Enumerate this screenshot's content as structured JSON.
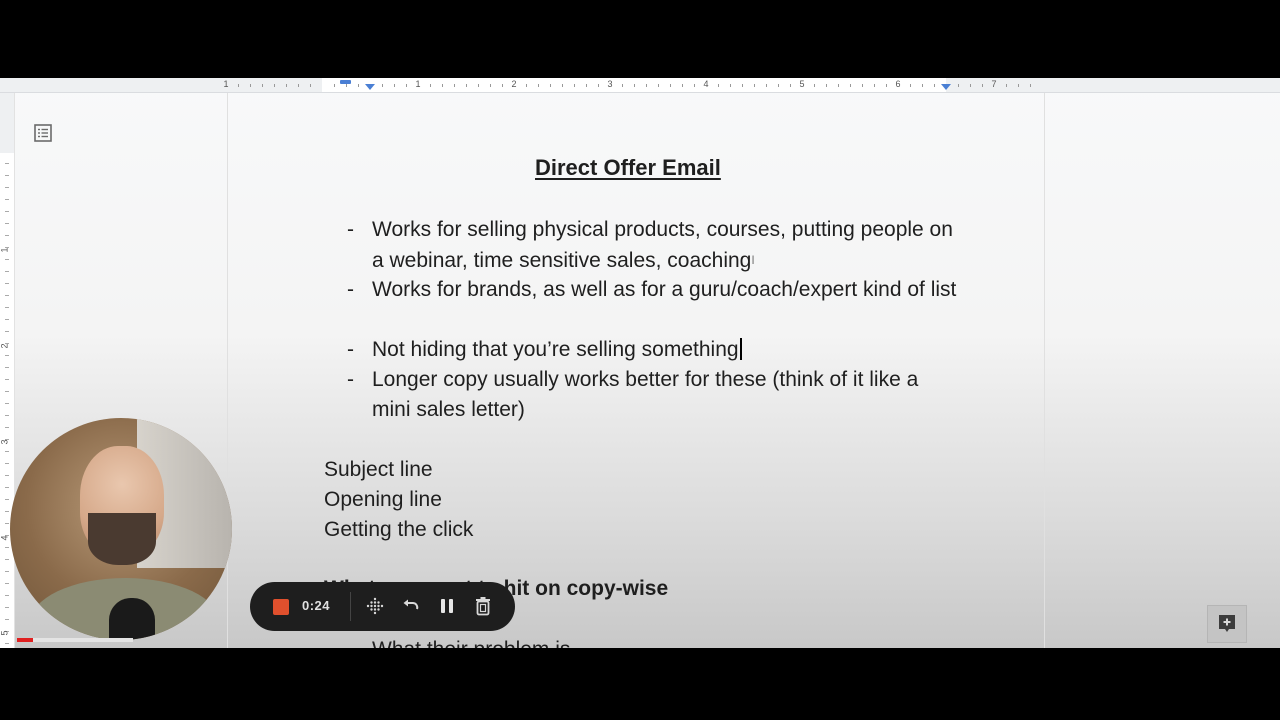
{
  "document": {
    "title": "Direct Offer Email",
    "bullets": [
      {
        "text": "Works for selling physical products, courses, putting people on a webinar, time sensitive sales, coaching"
      },
      {
        "text": "Works for brands, as well as for a guru/coach/expert kind of list"
      },
      {
        "text": "Not hiding that you’re selling something"
      },
      {
        "text": "Longer copy usually works better for these (think of it like a mini sales letter)"
      }
    ],
    "bullet_marker": "-",
    "lines": [
      "Subject line",
      "Opening line",
      "Getting the click"
    ],
    "section_heading": "What you want to hit on copy-wise",
    "partial_line": "What their problem is"
  },
  "ruler": {
    "horizontal_numbers": [
      "1",
      "1",
      "2",
      "3",
      "4",
      "5",
      "6",
      "7"
    ],
    "vertical_numbers": [
      "1",
      "2",
      "3",
      "4",
      "5"
    ]
  },
  "recorder": {
    "elapsed": "0:24",
    "stop_color": "#e0502d",
    "icons": [
      "stop-icon",
      "grid-icon",
      "undo-icon",
      "pause-icon",
      "trash-icon"
    ]
  },
  "video": {
    "progress_fraction": 0.14,
    "progress_color": "#e02020"
  },
  "sidebar": {
    "outline_icon": "document-outline-icon"
  },
  "side_actions": {
    "add_comment_icon": "add-comment-icon"
  }
}
